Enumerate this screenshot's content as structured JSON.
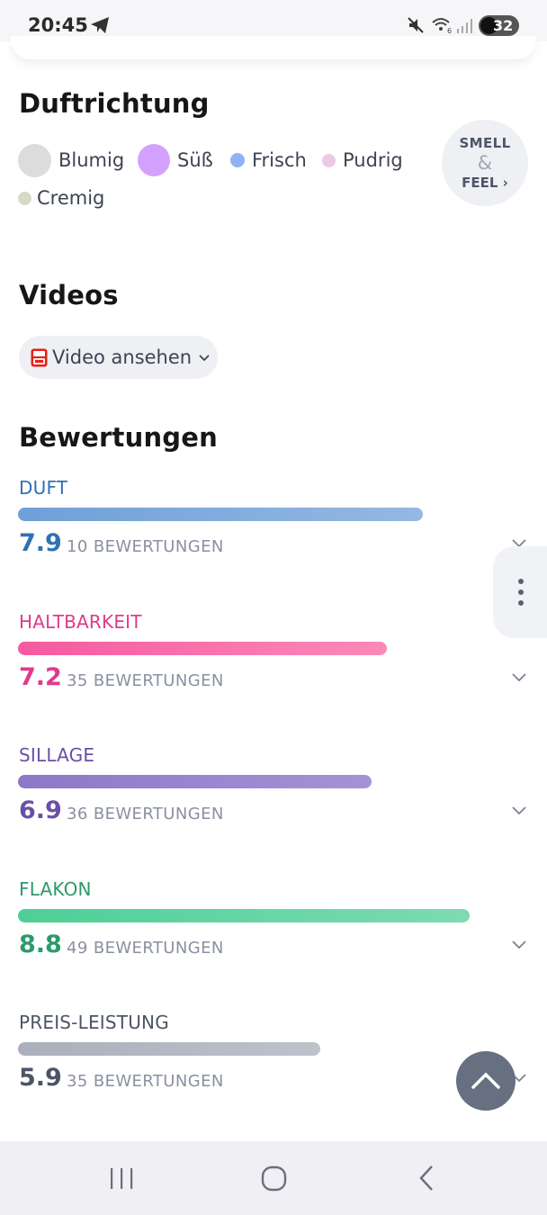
{
  "status_bar": {
    "time": "20:45",
    "battery": "32",
    "icons": [
      "telegram-icon",
      "mute-icon",
      "wifi-icon",
      "signal-icon",
      "battery-icon"
    ]
  },
  "fragrance_notes": {
    "title": "Duftrichtung",
    "accords": [
      {
        "label": "Blumig",
        "color": "#dcdcdc"
      },
      {
        "label": "Süß",
        "color": "#d4a1ff"
      },
      {
        "label": "Frisch",
        "color": "#8fb2f5"
      },
      {
        "label": "Pudrig",
        "color": "#eacbe6"
      },
      {
        "label": "Cremig",
        "color": "#d8d8c6"
      }
    ],
    "smell_feel": {
      "top": "SMELL",
      "amp": "&",
      "bottom": "FEEL ›"
    }
  },
  "videos": {
    "title": "Videos",
    "button_label": "Video ansehen",
    "icons": [
      "youtube-icon",
      "chevron-down-icon"
    ]
  },
  "ratings": {
    "title": "Bewertungen",
    "scale_max": 10,
    "items": [
      {
        "label": "DUFT",
        "score": "7.9",
        "count": "10 BEWERTUNGEN",
        "color": "#2f72b3",
        "bar_from": "#6fa0d8",
        "bar_to": "#95b8e3"
      },
      {
        "label": "HALTBARKEIT",
        "score": "7.2",
        "count": "35 BEWERTUNGEN",
        "color": "#e23a8b",
        "bar_from": "#f65aa0",
        "bar_to": "#fb8ab9"
      },
      {
        "label": "SILLAGE",
        "score": "6.9",
        "count": "36 BEWERTUNGEN",
        "color": "#6a4fa8",
        "bar_from": "#8c78c8",
        "bar_to": "#a792d6"
      },
      {
        "label": "FLAKON",
        "score": "8.8",
        "count": "49 BEWERTUNGEN",
        "color": "#2b9a6c",
        "bar_from": "#4ecf96",
        "bar_to": "#7ddbb2"
      },
      {
        "label": "PREIS-LEISTUNG",
        "score": "5.9",
        "count": "35 BEWERTUNGEN",
        "color": "#4c5566",
        "bar_from": "#a9b0bc",
        "bar_to": "#bdc2cb"
      }
    ]
  },
  "nav_bar": {
    "icons": [
      "recents-icon",
      "home-icon",
      "back-icon"
    ]
  }
}
